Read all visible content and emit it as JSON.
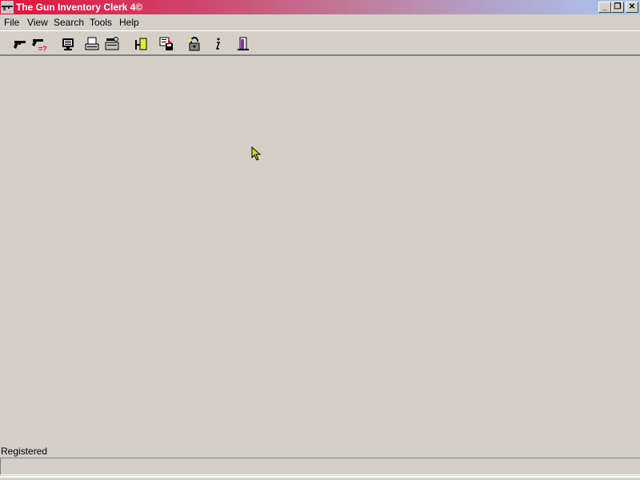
{
  "window": {
    "title": "The Gun Inventory Clerk 4©",
    "controls": {
      "minimize": "_",
      "restore": "❐",
      "close": "✕"
    }
  },
  "menu": [
    {
      "label": "File"
    },
    {
      "label": "View"
    },
    {
      "label": "Search"
    },
    {
      "label": "Tools"
    },
    {
      "label": "Help"
    }
  ],
  "toolbar": [
    {
      "icon": "gun-icon"
    },
    {
      "icon": "gun-search-icon"
    },
    {
      "icon": "monitor-icon"
    },
    {
      "icon": "printer-icon"
    },
    {
      "icon": "printer-settings-icon"
    },
    {
      "icon": "bookcase-icon"
    },
    {
      "icon": "save-export-icon"
    },
    {
      "icon": "lock-icon"
    },
    {
      "icon": "info-icon"
    },
    {
      "icon": "exit-door-icon"
    }
  ],
  "status": {
    "label": "Registered",
    "panel_text": ""
  }
}
